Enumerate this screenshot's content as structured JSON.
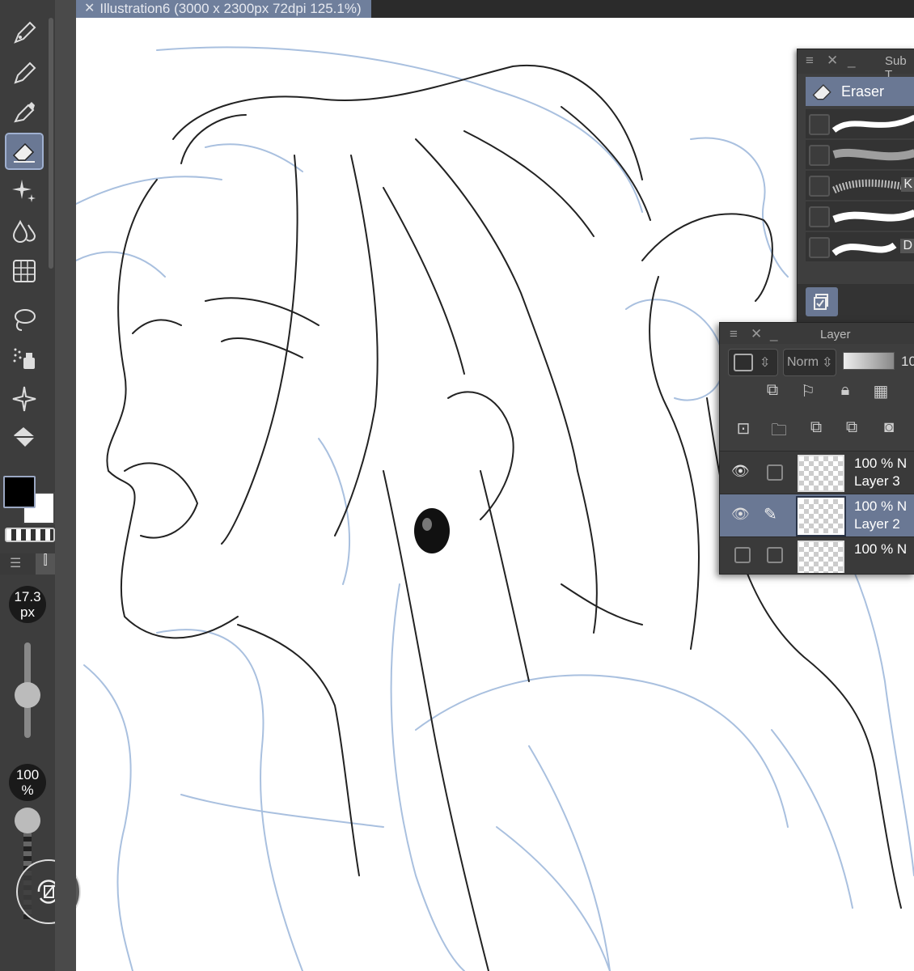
{
  "document_tab": {
    "close_glyph": "✕",
    "title": "Illustration6 (3000 x 2300px 72dpi 125.1%)"
  },
  "toolbar": {
    "tools": [
      {
        "name": "pen-icon"
      },
      {
        "name": "pencil-icon"
      },
      {
        "name": "brush-icon"
      },
      {
        "name": "eraser-icon",
        "active": true
      },
      {
        "name": "sparkle-decoration-icon"
      },
      {
        "name": "blend-drops-icon"
      },
      {
        "name": "grid-ruler-icon"
      },
      {
        "name": "lasso-select-icon"
      },
      {
        "name": "airbrush-icon"
      },
      {
        "name": "auto-select-wand-icon"
      },
      {
        "name": "fill-bucket-icon"
      }
    ],
    "main_color": "#000000",
    "sub_color": "#ffffff"
  },
  "brush_size": {
    "value": "17.3",
    "unit": "px",
    "level": 0.45
  },
  "brush_opacity": {
    "value": "100",
    "unit": "%",
    "level": 1.0
  },
  "sub_tool_panel": {
    "title": "Sub T",
    "active_tool": "Eraser",
    "brush_labels": [
      "",
      "",
      "K",
      "",
      "D"
    ]
  },
  "layer_panel": {
    "title": "Layer",
    "blend_mode": "Norm",
    "opacity_label": "10",
    "layers": [
      {
        "opacity": "100 % N",
        "name": "Layer 3",
        "visible": true,
        "selected": false
      },
      {
        "opacity": "100 % N",
        "name": "Layer 2",
        "visible": true,
        "selected": true
      },
      {
        "opacity": "100 % N",
        "name": "",
        "visible": false,
        "selected": false
      }
    ]
  },
  "colors": {
    "accent": "#6a7894",
    "sketch_blue": "#a9c0df",
    "panel_bg": "#3e3e3e"
  }
}
